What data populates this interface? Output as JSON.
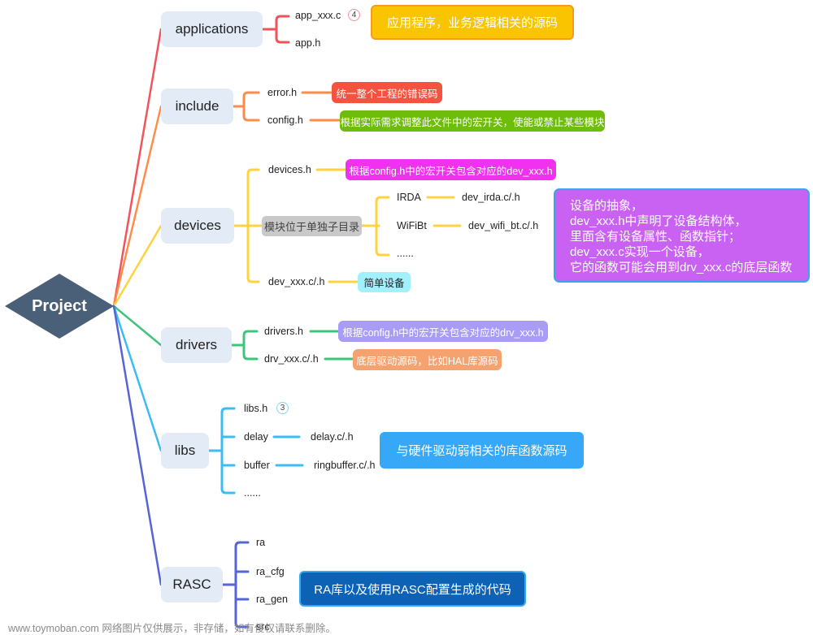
{
  "root": {
    "label": "Project",
    "color": "#4a6078"
  },
  "branches": {
    "applications": {
      "label": "applications",
      "color": "#f2545b",
      "children": [
        "app_xxx.c",
        "app.h"
      ],
      "badge": "4",
      "note": {
        "text": "应用程序，业务逻辑相关的源码",
        "bg": "#fbc400",
        "border": "#f59a23"
      }
    },
    "include": {
      "label": "include",
      "color": "#ff8c4b",
      "children": [
        "error.h",
        "config.h"
      ],
      "notes": [
        {
          "text": "统一整个工程的错误码",
          "bg": "#f5523f"
        },
        {
          "text": "根据实际需求调整此文件中的宏开关，使能或禁止某些模块",
          "bg": "#6ebd0c"
        }
      ]
    },
    "devices": {
      "label": "devices",
      "color": "#ffd23f",
      "children": [
        "devices.h",
        "模块位于单独子目录",
        "dev_xxx.c/.h"
      ],
      "sub": [
        "IRDA",
        "WiFiBt",
        "......"
      ],
      "subfiles": [
        "dev_irda.c/.h",
        "dev_wifi_bt.c/.h"
      ],
      "notes": [
        {
          "text": "根据config.h中的宏开关包含对应的dev_xxx.h",
          "bg": "#f032f0"
        },
        {
          "text": "简单设备",
          "bg": "#a2f0fc"
        }
      ],
      "summary": [
        "设备的抽象，",
        "dev_xxx.h中声明了设备结构体，",
        "里面含有设备属性、函数指针；",
        "dev_xxx.c实现一个设备，",
        "它的函数可能会用到drv_xxx.c的底层函数"
      ]
    },
    "drivers": {
      "label": "drivers",
      "color": "#3fc47c",
      "children": [
        "drivers.h",
        "drv_xxx.c/.h"
      ],
      "notes": [
        {
          "text": "根据config.h中的宏开关包含对应的drv_xxx.h",
          "bg": "#a99cf7"
        },
        {
          "text": "底层驱动源码，比如HAL库源码",
          "bg": "#f4a26f"
        }
      ]
    },
    "libs": {
      "label": "libs",
      "color": "#3bbcf5",
      "children": [
        "libs.h",
        "delay",
        "buffer",
        "......"
      ],
      "badge": "3",
      "subfiles": [
        "delay.c/.h",
        "ringbuffer.c/.h"
      ],
      "note": {
        "text": "与硬件驱动弱相关的库函数源码",
        "bg": "#36a8f7"
      }
    },
    "rasc": {
      "label": "RASC",
      "color": "#5565d6",
      "children": [
        "ra",
        "ra_cfg",
        "ra_gen",
        "src"
      ],
      "note": {
        "text": "RA库以及使用RASC配置生成的代码",
        "bg": "#0d62b5",
        "border": "#36a8f0"
      }
    }
  },
  "watermark": "www.toymoban.com 网络图片仅供展示，非存储，如有侵权请联系删除。"
}
